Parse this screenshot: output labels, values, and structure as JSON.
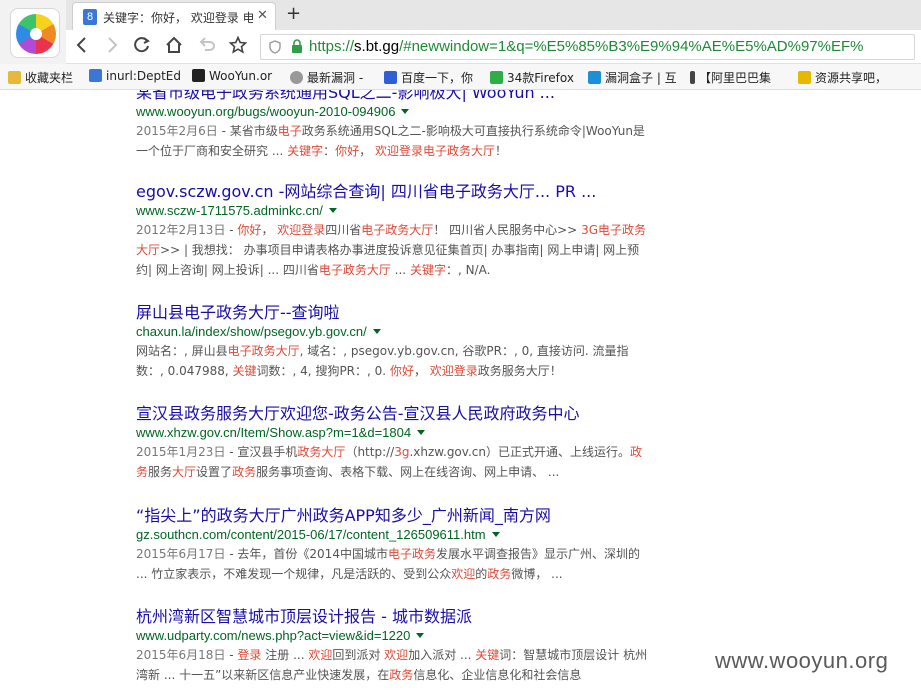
{
  "tab": {
    "favicon": "8",
    "title": "关键字：你好， 欢迎登录 电",
    "close": "✕",
    "new_tab": "+"
  },
  "toolbar": {
    "back_icon": "arrow-left-icon",
    "forward_icon": "arrow-right-icon",
    "reload_icon": "reload-icon",
    "home_icon": "home-icon",
    "undo_icon": "undo-icon",
    "star_icon": "star-icon",
    "url_scheme": "https://",
    "url_host": "s.bt.gg",
    "url_rest": "/#newwindow=1&q=%E5%85%B3%E9%94%AE%E5%AD%97%EF%"
  },
  "bookmarks": [
    {
      "label": "收藏夹栏",
      "color": "#e8b83a"
    },
    {
      "label": "inurl:DeptEd",
      "color": "#3a78d8"
    },
    {
      "label": "WooYun.or",
      "color": "#222222"
    },
    {
      "label": "最新漏洞 -",
      "color": "#999999"
    },
    {
      "label": "百度一下，你",
      "color": "#2e5fd6"
    },
    {
      "label": "34款Firefox",
      "color": "#2fae48"
    },
    {
      "label": "漏洞盒子 | 互",
      "color": "#1d8fd6"
    },
    {
      "label": "【阿里巴巴集",
      "color": "#444444"
    },
    {
      "label": "资源共享吧，",
      "color": "#e6b800"
    }
  ],
  "results": [
    {
      "title": "某省市级电子政务系统通用SQL之二-影响极大| WooYun ...",
      "url": "www.wooyun.org/bugs/wooyun-2010-094906",
      "snippet": [
        {
          "t": "2015年2月6日",
          "c": "date"
        },
        {
          "t": " - 某省市级"
        },
        {
          "t": "电子",
          "c": "hl"
        },
        {
          "t": "政务系统通用SQL之二-影响极大可直接执行系统命令|WooYun是一个位于厂商和安全研究 ... "
        },
        {
          "t": "关键字",
          "c": "hl"
        },
        {
          "t": "："
        },
        {
          "t": "你好",
          "c": "hl"
        },
        {
          "t": "， "
        },
        {
          "t": "欢迎登录电子政务大厅",
          "c": "hl"
        },
        {
          "t": "！"
        }
      ]
    },
    {
      "title": "egov.sczw.gov.cn -网站综合查询| 四川省电子政务大厅... PR ...",
      "url": "www.sczw-1711575.adminkc.cn/",
      "snippet": [
        {
          "t": "2012年2月13日",
          "c": "date"
        },
        {
          "t": " - "
        },
        {
          "t": "你好",
          "c": "hl"
        },
        {
          "t": "， "
        },
        {
          "t": "欢迎登录",
          "c": "hl"
        },
        {
          "t": "四川省"
        },
        {
          "t": "电子政务大厅",
          "c": "hl"
        },
        {
          "t": "！ 四川省人民服务中心>> "
        },
        {
          "t": "3G电子政务大厅",
          "c": "hl"
        },
        {
          "t": ">> | 我想找： 办事项目申请表格办事进度投诉意见征集首页| 办事指南| 网上申请| 网上预约| 网上咨询| 网上投诉| ... 四川省"
        },
        {
          "t": "电子政务大厅",
          "c": "hl"
        },
        {
          "t": " ... "
        },
        {
          "t": "关键字",
          "c": "hl"
        },
        {
          "t": "：, N/A."
        }
      ]
    },
    {
      "title": "屏山县电子政务大厅--查询啦",
      "url": "chaxun.la/index/show/psegov.yb.gov.cn/",
      "snippet": [
        {
          "t": "网站名：, 屏山县"
        },
        {
          "t": "电子政务大厅",
          "c": "hl"
        },
        {
          "t": ", 域名：, psegov.yb.gov.cn, 谷歌PR：, 0, 直接访问. 流量指数：, 0.047988, "
        },
        {
          "t": "关键",
          "c": "hl"
        },
        {
          "t": "词数：, 4, 搜狗PR：, 0. "
        },
        {
          "t": "你好",
          "c": "hl"
        },
        {
          "t": "， "
        },
        {
          "t": "欢迎登录",
          "c": "hl"
        },
        {
          "t": "政务服务大厅！"
        }
      ]
    },
    {
      "title": "宣汉县政务服务大厅欢迎您-政务公告-宣汉县人民政府政务中心",
      "url": "www.xhzw.gov.cn/Item/Show.asp?m=1&d=1804",
      "snippet": [
        {
          "t": "2015年1月23日",
          "c": "date"
        },
        {
          "t": " - 宣汉县手机"
        },
        {
          "t": "政务大厅",
          "c": "hl"
        },
        {
          "t": "（http://"
        },
        {
          "t": "3g",
          "c": "hl"
        },
        {
          "t": ".xhzw.gov.cn）已正式开通、上线运行。"
        },
        {
          "t": "政务",
          "c": "hl"
        },
        {
          "t": "服务"
        },
        {
          "t": "大厅",
          "c": "hl"
        },
        {
          "t": "设置了"
        },
        {
          "t": "政务",
          "c": "hl"
        },
        {
          "t": "服务事项查询、表格下载、网上在线咨询、网上申请、 ..."
        }
      ]
    },
    {
      "title": "“指尖上”的政务大厅广州政务APP知多少_广州新闻_南方网",
      "url": "gz.southcn.com/content/2015-06/17/content_126509611.htm",
      "snippet": [
        {
          "t": "2015年6月17日",
          "c": "date"
        },
        {
          "t": " - 去年，首份《2014中国城市"
        },
        {
          "t": "电子政务",
          "c": "hl"
        },
        {
          "t": "发展水平调查报告》显示广州、深圳的 ... 竹立家表示，不难发现一个规律，凡是活跃的、受到公众"
        },
        {
          "t": "欢迎",
          "c": "hl"
        },
        {
          "t": "的"
        },
        {
          "t": "政务",
          "c": "hl"
        },
        {
          "t": "微博， ..."
        }
      ]
    },
    {
      "title": "杭州湾新区智慧城市顶层设计报告 - 城市数据派",
      "url": "www.udparty.com/news.php?act=view&id=1220",
      "snippet": [
        {
          "t": "2015年6月18日",
          "c": "date"
        },
        {
          "t": " - "
        },
        {
          "t": "登录",
          "c": "hl"
        },
        {
          "t": " 注册 ... "
        },
        {
          "t": "欢迎",
          "c": "hl"
        },
        {
          "t": "回到派对 "
        },
        {
          "t": "欢迎",
          "c": "hl"
        },
        {
          "t": "加入派对 ... "
        },
        {
          "t": "关键",
          "c": "hl"
        },
        {
          "t": "词：智慧城市顶层设计 杭州湾新 ... 十一五”以来新区信息产业快速发展，在"
        },
        {
          "t": "政务",
          "c": "hl"
        },
        {
          "t": "信息化、企业信息化和社会信息"
        }
      ]
    }
  ],
  "watermark": "www.wooyun.org"
}
